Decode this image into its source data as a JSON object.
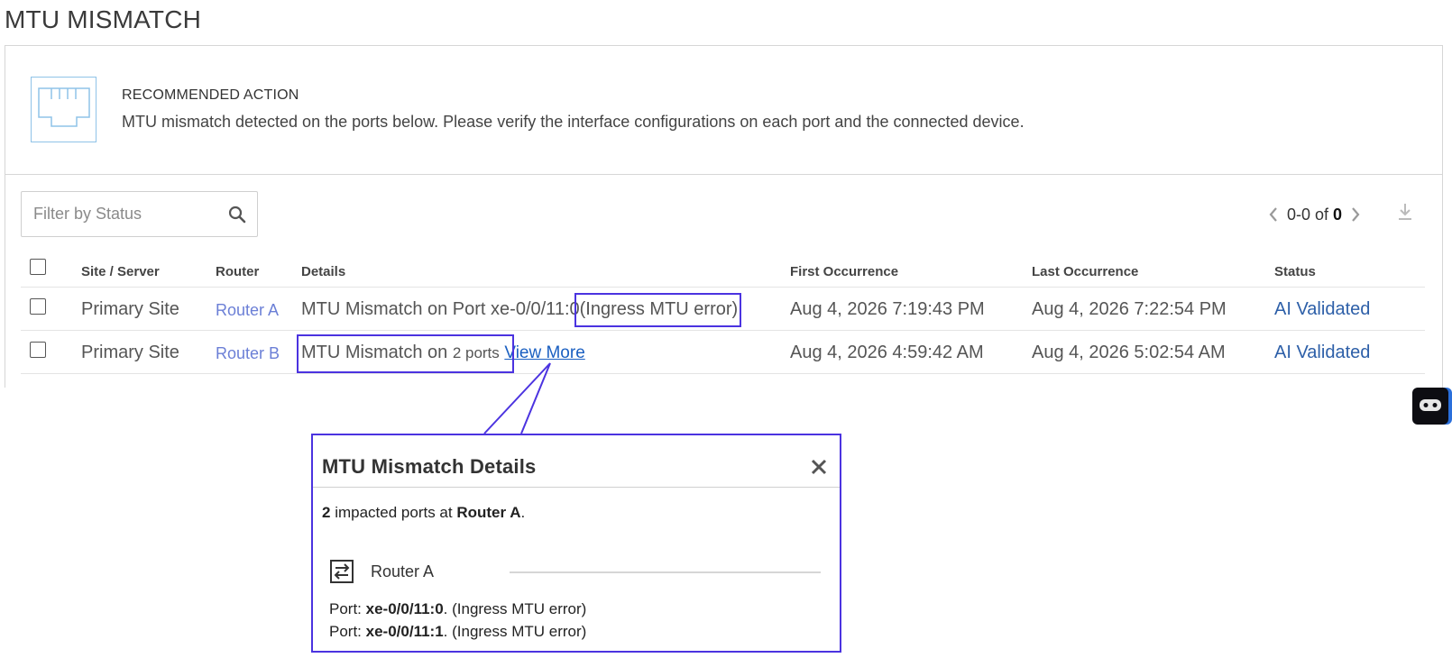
{
  "page": {
    "title": "MTU MISMATCH"
  },
  "recommended": {
    "heading": "RECOMMENDED ACTION",
    "text": "MTU mismatch detected on the ports below. Please verify the interface configurations on each port and the connected device.",
    "icon": "ethernet-port-icon"
  },
  "filter": {
    "placeholder": "Filter by Status",
    "value": ""
  },
  "pager": {
    "range": "0-0 of",
    "total": "0"
  },
  "table": {
    "headers": {
      "site": "Site / Server",
      "router": "Router",
      "details": "Details",
      "first": "First Occurrence",
      "last": "Last Occurrence",
      "status": "Status"
    },
    "rows": [
      {
        "site": "Primary Site",
        "router": "Router A",
        "details_main": "MTU Mismatch on Port xe-0/0/11:0",
        "details_extra": "(Ingress MTU error)",
        "first": "Aug 4, 2026 7:19:43 PM",
        "last": "Aug 4, 2026 7:22:54 PM",
        "status": "AI Validated"
      },
      {
        "site": "Primary Site",
        "router": "Router B",
        "details_main": "MTU Mismatch on",
        "details_count": "2 ports",
        "details_link": "View More",
        "first": "Aug 4, 2026 4:59:42 AM",
        "last": "Aug 4, 2026 5:02:54 AM",
        "status": "AI Validated"
      }
    ]
  },
  "popup": {
    "title": "MTU Mismatch Details",
    "summary_count": "2",
    "summary_mid": "impacted ports at",
    "summary_router": "Router A",
    "summary_end": ".",
    "router_name": "Router A",
    "ports": [
      {
        "prefix": "Port:",
        "name": "xe-0/0/11:0",
        "suffix": ". (Ingress MTU error)"
      },
      {
        "prefix": "Port:",
        "name": "xe-0/0/11:1",
        "suffix": ". (Ingress MTU error)"
      }
    ]
  },
  "colors": {
    "accent": "#4b33e0",
    "router_link": "#6b7fd6",
    "status": "#2d5fa8",
    "icon_border": "#8fc3e8"
  }
}
